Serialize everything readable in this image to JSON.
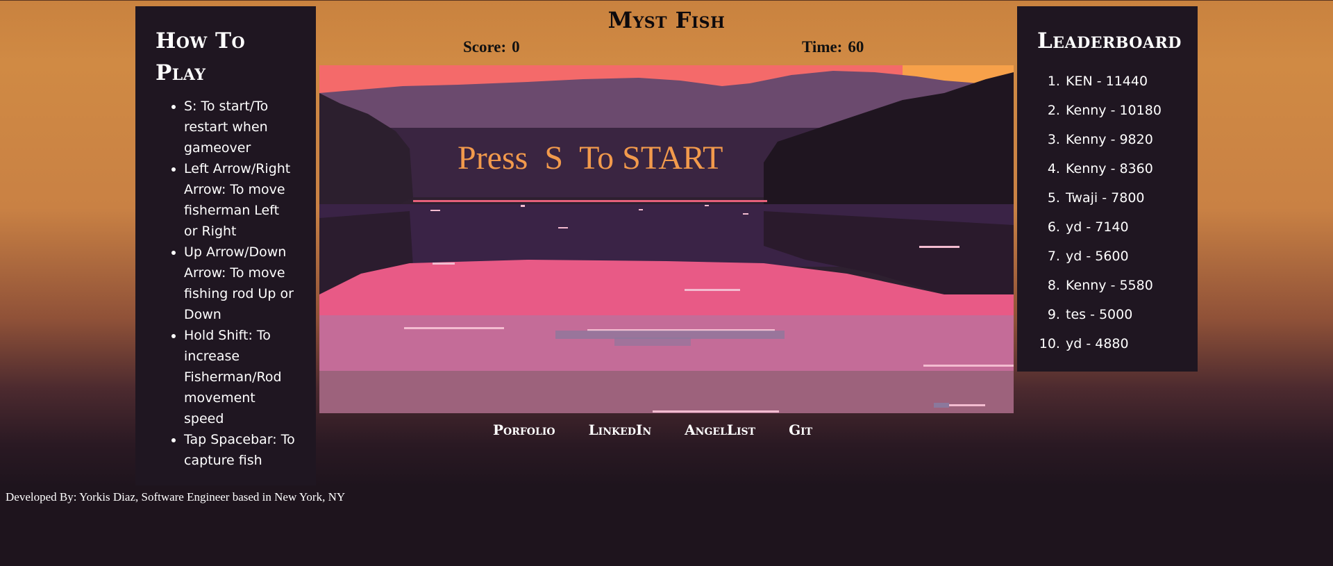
{
  "game": {
    "title": "Myst Fish",
    "score_label": "Score:",
    "score_value": "0",
    "time_label": "Time:",
    "time_value": "60",
    "start_message": "Press  S  To START"
  },
  "how_to_play": {
    "title": "How To Play",
    "items": [
      "S: To start/To restart when gameover",
      "Left Arrow/Right Arrow: To move fisherman Left or Right",
      "Up Arrow/Down Arrow: To move fishing rod Up or Down",
      "Hold Shift: To increase Fisherman/Rod movement speed",
      "Tap Spacebar: To capture fish"
    ]
  },
  "leaderboard": {
    "title": "Leaderboard",
    "entries": [
      "KEN - 11440",
      "Kenny - 10180",
      "Kenny - 9820",
      "Kenny - 8360",
      "Twaji - 7800",
      "yd - 7140",
      "yd - 5600",
      "Kenny - 5580",
      "tes - 5000",
      "yd - 4880"
    ]
  },
  "links": [
    "Porfolio",
    "LinkedIn",
    "AngelList",
    "Git"
  ],
  "footer": {
    "text": "Developed By: Yorkis Diaz, Software Engineer based in New York, NY"
  },
  "colors": {
    "panel_bg": "#1f1621",
    "start_text": "#f29a4c",
    "sky_top": "#f46a6a",
    "water_pink": "#e85a86"
  }
}
